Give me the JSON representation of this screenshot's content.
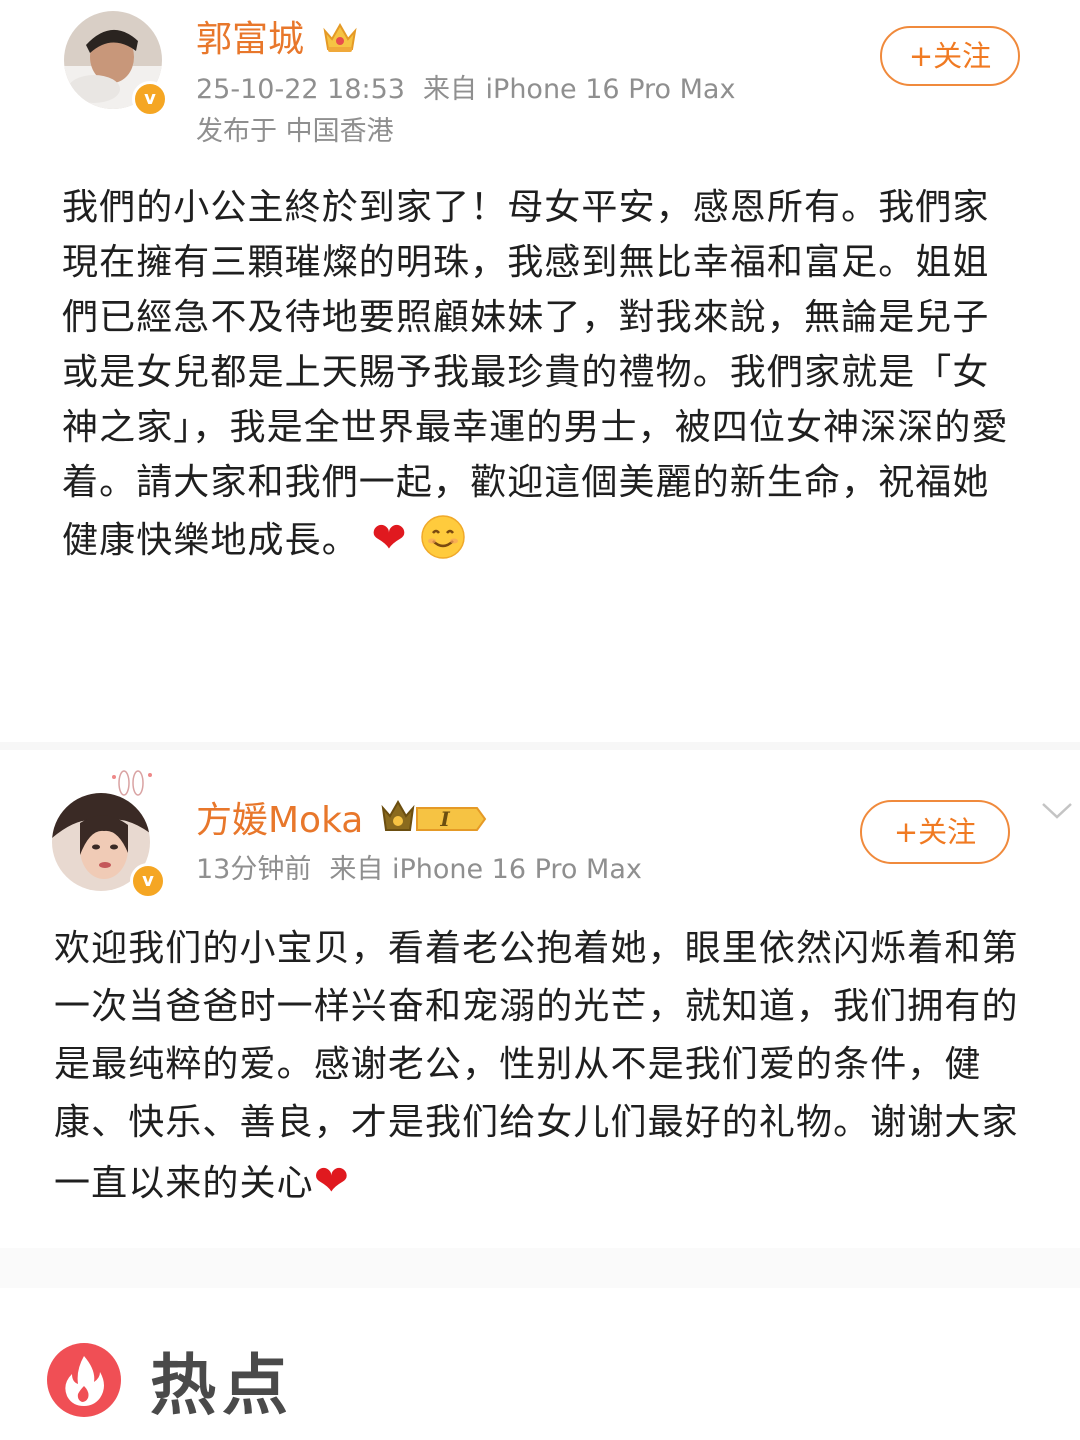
{
  "post1": {
    "author": "郭富城",
    "crown_icon": "crown-badge-icon",
    "time": "25-10-22 18:53",
    "source": "来自 iPhone 16 Pro Max",
    "location": "发布于 中国香港",
    "follow_label": "+关注",
    "text": "我們的小公主終於到家了！母女平安，感恩所有。我們家現在擁有三顆璀燦的明珠，我感到無比幸福和富足。姐姐們已經急不及待地要照顧妹妹了，對我來說，無論是兒子或是女兒都是上天賜予我最珍貴的禮物。我們家就是「女神之家」，我是全世界最幸運的男士，被四位女神深深的愛着。請大家和我們一起，歡迎這個美麗的新生命，祝福她健康快樂地成長。",
    "emojis": [
      "heart",
      "smile"
    ]
  },
  "post2": {
    "author": "方媛Moka",
    "crown_icon": "crown-level-badge-icon",
    "level": "I",
    "time": "13分钟前",
    "source": "来自 iPhone 16 Pro Max",
    "follow_label": "+关注",
    "text": "欢迎我们的小宝贝，看着老公抱着她，眼里依然闪烁着和第一次当爸爸时一样兴奋和宠溺的光芒，就知道，我们拥有的是最纯粹的爱。感谢老公，性别从不是我们爱的条件，健康、快乐、善良，才是我们给女儿们最好的礼物。谢谢大家一直以来的关心",
    "emojis": [
      "heart"
    ]
  },
  "hot_section": {
    "label": "热点"
  },
  "colors": {
    "accent": "#e8772b",
    "follow_border": "#f08a3c",
    "verified_badge": "#f5a623",
    "hot_icon": "#f04f55",
    "meta_text": "#8f8f8f"
  }
}
